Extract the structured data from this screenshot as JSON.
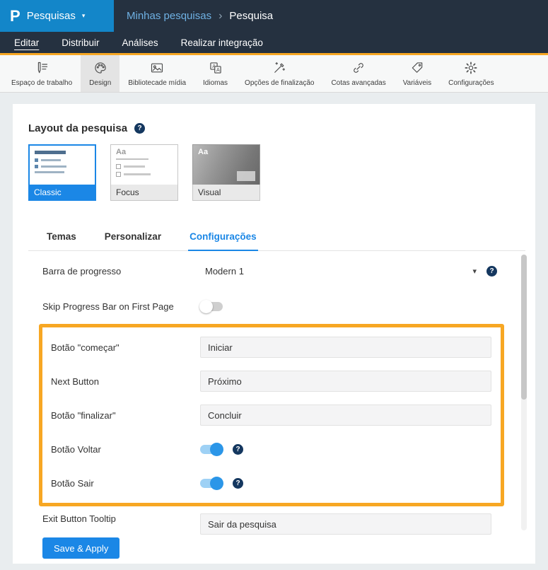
{
  "colors": {
    "brand_blue": "#1b87e6",
    "topbar_bg": "#253140",
    "logo_bg": "#1386c9",
    "accent_orange": "#f7a723",
    "highlight_border": "#f7a723",
    "help_badge": "#14375f",
    "toggle_on": "#2b96e8"
  },
  "icons": {
    "caret_down": "▾",
    "breadcrumb_sep": "›",
    "help": "?"
  },
  "topbar": {
    "logo": "P",
    "product_menu": "Pesquisas",
    "breadcrumb": {
      "parent": "Minhas pesquisas",
      "current": "Pesquisa"
    }
  },
  "nav": {
    "tabs": [
      {
        "label": "Editar",
        "active": true
      },
      {
        "label": "Distribuir",
        "active": false
      },
      {
        "label": "Análises",
        "active": false
      },
      {
        "label": "Realizar integração",
        "active": false
      }
    ]
  },
  "toolbar": {
    "items": [
      {
        "label": "Espaço de trabalho",
        "icon": "workspace-pencil-icon",
        "active": false
      },
      {
        "label": "Design",
        "icon": "palette-icon",
        "active": true
      },
      {
        "label": "Bibliotecade mídia",
        "icon": "media-image-icon",
        "active": false
      },
      {
        "label": "Idiomas",
        "icon": "translate-icon",
        "active": false
      },
      {
        "label": "Opções de finalização",
        "icon": "magic-wand-icon",
        "active": false
      },
      {
        "label": "Cotas avançadas",
        "icon": "chain-links-icon",
        "active": false
      },
      {
        "label": "Variáveis",
        "icon": "tag-icon",
        "active": false
      },
      {
        "label": "Configurações",
        "icon": "gear-icon",
        "active": false
      }
    ]
  },
  "survey_layout": {
    "title": "Layout da pesquisa",
    "thumb_text": "Aa",
    "options": [
      {
        "label": "Classic",
        "selected": true
      },
      {
        "label": "Focus",
        "selected": false
      },
      {
        "label": "Visual",
        "selected": false
      }
    ]
  },
  "design_tabs": [
    {
      "label": "Temas",
      "active": false
    },
    {
      "label": "Personalizar",
      "active": false
    },
    {
      "label": "Configurações",
      "active": true
    }
  ],
  "settings": {
    "progress_bar": {
      "label": "Barra de progresso",
      "value": "Modern 1"
    },
    "skip_progress": {
      "label": "Skip Progress Bar on First Page",
      "enabled": false
    },
    "start_button": {
      "label": "Botão \"começar\"",
      "value": "Iniciar"
    },
    "next_button": {
      "label": "Next Button",
      "value": "Próximo"
    },
    "finish_button": {
      "label": "Botão \"finalizar\"",
      "value": "Concluir"
    },
    "back_button": {
      "label": "Botão Voltar",
      "enabled": true
    },
    "exit_button": {
      "label": "Botão Sair",
      "enabled": true
    },
    "exit_tooltip": {
      "label": "Exit Button Tooltip",
      "value": "Sair da pesquisa"
    }
  },
  "actions": {
    "save": "Save & Apply"
  }
}
